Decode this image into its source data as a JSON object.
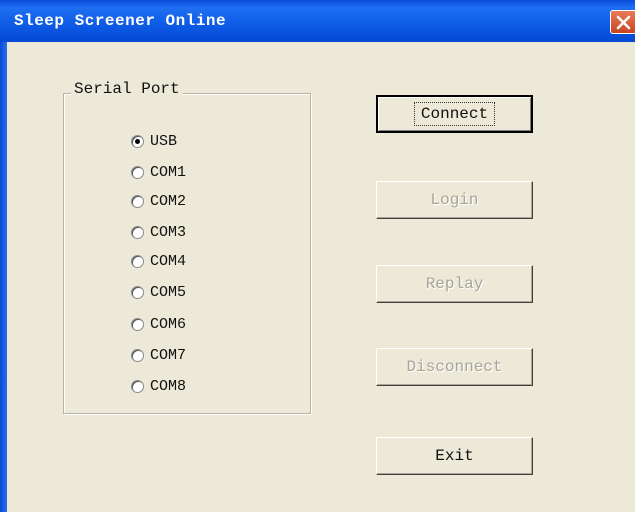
{
  "window": {
    "title": "Sleep Screener Online"
  },
  "serial_port": {
    "legend": "Serial Port",
    "selected": "USB",
    "options": [
      "USB",
      "COM1",
      "COM2",
      "COM3",
      "COM4",
      "COM5",
      "COM6",
      "COM7",
      "COM8"
    ]
  },
  "buttons": {
    "connect": "Connect",
    "login": "Login",
    "replay": "Replay",
    "disconnect": "Disconnect",
    "exit": "Exit"
  },
  "colors": {
    "titlebar": "#0a4bd8",
    "close_button": "#c84520",
    "face": "#ece9d8"
  }
}
